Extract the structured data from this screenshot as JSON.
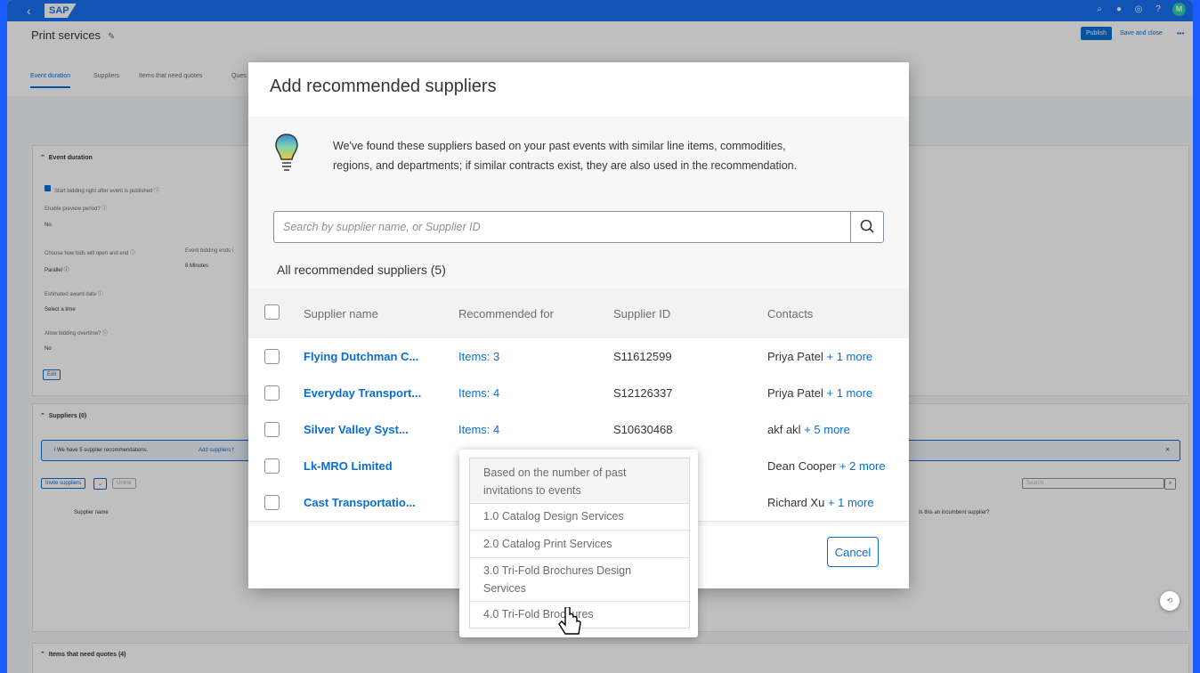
{
  "shell": {
    "logo": "SAP",
    "back": "‹",
    "avatar": "M"
  },
  "page": {
    "title": "Print services",
    "publish": "Publish",
    "save_close": "Save and close",
    "more": "•••"
  },
  "tabs": [
    "Event duration",
    "Suppliers",
    "Items that need quotes",
    "Ques"
  ],
  "background": {
    "event_duration": {
      "title": "Event duration",
      "start_bidding": "Start bidding right after event is published ⓘ",
      "enable_preview": "Enable preview period? ⓘ",
      "enable_preview_val": "No",
      "choose_bids": "Choose how bids will open and end ⓘ",
      "event_bidding_ends": "Event bidding ends i",
      "parallel": "Parallel ⓘ",
      "minutes": "8 Minutes",
      "est_award": "Estimated award date ⓘ",
      "select_time": "Select a time",
      "allow_overtime": "Allow bidding overtime? ⓘ",
      "allow_overtime_val": "No",
      "edit": "Edit"
    },
    "suppliers": {
      "title": "Suppliers (0)",
      "strip": "i   We have 5 supplier recommendations.",
      "strip_link": "Add suppliers f",
      "invite": "Invite suppliers",
      "remove": "Unlink",
      "search": "Search",
      "col_name": "Supplier name",
      "col_incumbent": "Is this an incumbent supplier?"
    },
    "items_title": "Items that need quotes (4)"
  },
  "dialog": {
    "title": "Add recommended suppliers",
    "info": "We've found these suppliers based on your past events with similar line items, commodities, regions, and departments; if similar contracts exist, they are also used in the recommendation.",
    "search_placeholder": "Search by supplier name, or Supplier ID",
    "count": "All recommended suppliers (5)",
    "columns": {
      "name": "Supplier name",
      "recommended": "Recommended for",
      "id": "Supplier ID",
      "contacts": "Contacts"
    },
    "rows": [
      {
        "name": "Flying Dutchman C...",
        "items": "Items: 3",
        "id": "S11612599",
        "contact": "Priya Patel",
        "more": "+ 1 more"
      },
      {
        "name": "Everyday Transport...",
        "items": "Items: 4",
        "id": "S12126337",
        "contact": "Priya Patel",
        "more": "+ 1 more"
      },
      {
        "name": "Silver Valley Syst...",
        "items": "Items: 4",
        "id": "S10630468",
        "contact": "akf akl",
        "more": "+ 5 more"
      },
      {
        "name": "Lk-MRO Limited",
        "items": "",
        "id": "",
        "contact": "Dean Cooper",
        "more": "+ 2 more"
      },
      {
        "name": "Cast Transportatio...",
        "items": "",
        "id": "",
        "contact": "Richard Xu",
        "more": "+ 1 more"
      }
    ],
    "cancel": "Cancel"
  },
  "popover": {
    "header": "Based on the number of past invitations to events",
    "items": [
      "1.0 Catalog Design Services",
      "2.0 Catalog Print Services",
      "3.0 Tri-Fold Brochures Design Services",
      "4.0 Tri-Fold Brochures"
    ]
  }
}
